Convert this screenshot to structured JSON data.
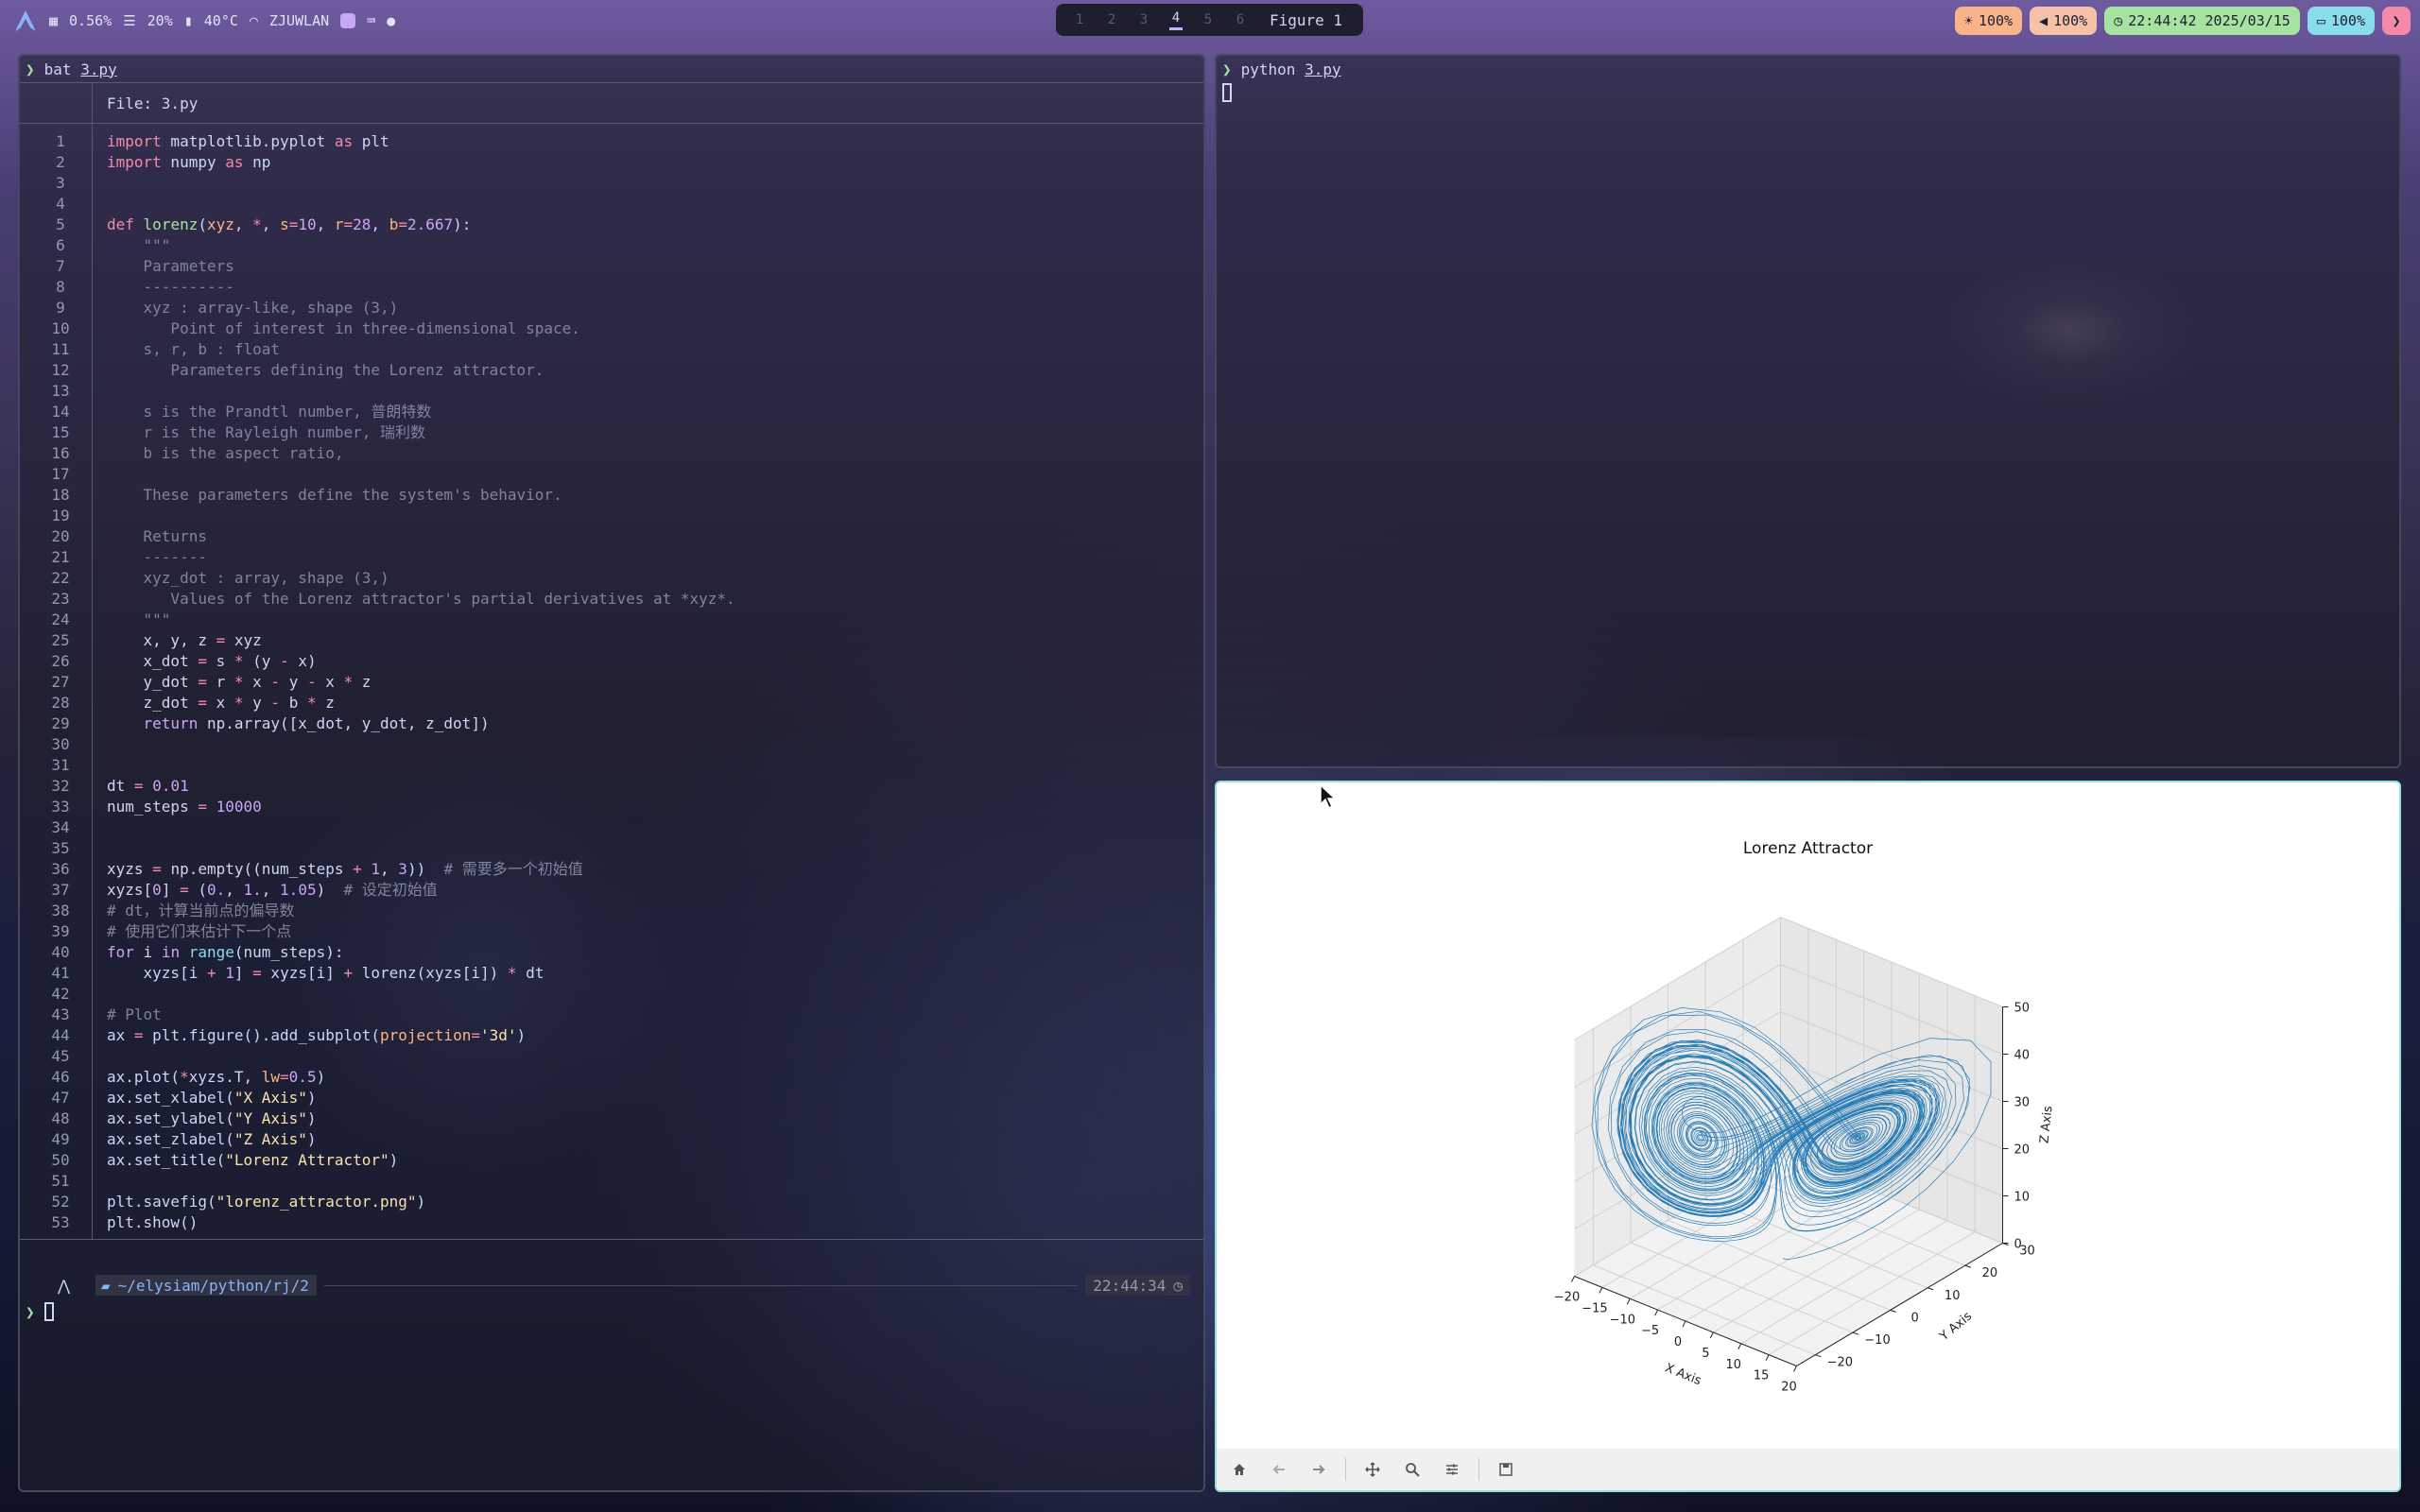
{
  "topbar": {
    "cpu": "0.56%",
    "mem": "20%",
    "temp": "40°C",
    "wifi": "ZJUWLAN",
    "workspaces": [
      "1",
      "2",
      "3",
      "4",
      "5",
      "6"
    ],
    "active_workspace": 4,
    "window_title": "Figure 1",
    "brightness": "100%",
    "volume": "100%",
    "datetime": "22:44:42 2025/03/15",
    "battery": "100%"
  },
  "left_terminal": {
    "command": "bat",
    "command_arg": "3.py",
    "file_header": "File: 3.py",
    "code_lines": [
      [
        [
          "k",
          "import"
        ],
        [
          "t",
          " matplotlib.pyplot "
        ],
        [
          "k",
          "as"
        ],
        [
          "t",
          " plt"
        ]
      ],
      [
        [
          "k",
          "import"
        ],
        [
          "t",
          " numpy "
        ],
        [
          "k",
          "as"
        ],
        [
          "t",
          " np"
        ]
      ],
      [],
      [],
      [
        [
          "k",
          "def"
        ],
        [
          "t",
          " "
        ],
        [
          "fn",
          "lorenz"
        ],
        [
          "t",
          "("
        ],
        [
          "arg",
          "xyz"
        ],
        [
          "t",
          ", "
        ],
        [
          "op",
          "*"
        ],
        [
          "t",
          ", "
        ],
        [
          "arg",
          "s"
        ],
        [
          "op",
          "="
        ],
        [
          "num",
          "10"
        ],
        [
          "t",
          ", "
        ],
        [
          "arg",
          "r"
        ],
        [
          "op",
          "="
        ],
        [
          "num",
          "28"
        ],
        [
          "t",
          ", "
        ],
        [
          "arg",
          "b"
        ],
        [
          "op",
          "="
        ],
        [
          "num",
          "2.667"
        ],
        [
          "t",
          "):"
        ]
      ],
      [
        [
          "doc",
          "    \"\"\""
        ]
      ],
      [
        [
          "doc",
          "    Parameters"
        ]
      ],
      [
        [
          "doc",
          "    ----------"
        ]
      ],
      [
        [
          "doc",
          "    xyz : array-like, shape (3,)"
        ]
      ],
      [
        [
          "doc",
          "       Point of interest in three-dimensional space."
        ]
      ],
      [
        [
          "doc",
          "    s, r, b : float"
        ]
      ],
      [
        [
          "doc",
          "       Parameters defining the Lorenz attractor."
        ]
      ],
      [],
      [
        [
          "doc",
          "    s is the Prandtl number, 普朗特数"
        ]
      ],
      [
        [
          "doc",
          "    r is the Rayleigh number, 瑞利数"
        ]
      ],
      [
        [
          "doc",
          "    b is the aspect ratio,"
        ]
      ],
      [],
      [
        [
          "doc",
          "    These parameters define the system's behavior."
        ]
      ],
      [],
      [
        [
          "doc",
          "    Returns"
        ]
      ],
      [
        [
          "doc",
          "    -------"
        ]
      ],
      [
        [
          "doc",
          "    xyz_dot : array, shape (3,)"
        ]
      ],
      [
        [
          "doc",
          "       Values of the Lorenz attractor's partial derivatives at *xyz*."
        ]
      ],
      [
        [
          "doc",
          "    \"\"\""
        ]
      ],
      [
        [
          "t",
          "    x, y, z "
        ],
        [
          "op",
          "="
        ],
        [
          "t",
          " xyz"
        ]
      ],
      [
        [
          "t",
          "    x_dot "
        ],
        [
          "op",
          "="
        ],
        [
          "t",
          " s "
        ],
        [
          "op",
          "*"
        ],
        [
          "t",
          " (y "
        ],
        [
          "op",
          "-"
        ],
        [
          "t",
          " x)"
        ]
      ],
      [
        [
          "t",
          "    y_dot "
        ],
        [
          "op",
          "="
        ],
        [
          "t",
          " r "
        ],
        [
          "op",
          "*"
        ],
        [
          "t",
          " x "
        ],
        [
          "op",
          "-"
        ],
        [
          "t",
          " y "
        ],
        [
          "op",
          "-"
        ],
        [
          "t",
          " x "
        ],
        [
          "op",
          "*"
        ],
        [
          "t",
          " z"
        ]
      ],
      [
        [
          "t",
          "    z_dot "
        ],
        [
          "op",
          "="
        ],
        [
          "t",
          " x "
        ],
        [
          "op",
          "*"
        ],
        [
          "t",
          " y "
        ],
        [
          "op",
          "-"
        ],
        [
          "t",
          " b "
        ],
        [
          "op",
          "*"
        ],
        [
          "t",
          " z"
        ]
      ],
      [
        [
          "kp",
          "    return"
        ],
        [
          "t",
          " np.array([x_dot, y_dot, z_dot])"
        ]
      ],
      [],
      [],
      [
        [
          "t",
          "dt "
        ],
        [
          "op",
          "="
        ],
        [
          "t",
          " "
        ],
        [
          "num",
          "0.01"
        ]
      ],
      [
        [
          "t",
          "num_steps "
        ],
        [
          "op",
          "="
        ],
        [
          "t",
          " "
        ],
        [
          "num",
          "10000"
        ]
      ],
      [],
      [],
      [
        [
          "t",
          "xyzs "
        ],
        [
          "op",
          "="
        ],
        [
          "t",
          " np.empty((num_steps "
        ],
        [
          "op",
          "+"
        ],
        [
          "t",
          " "
        ],
        [
          "num",
          "1"
        ],
        [
          "t",
          ", "
        ],
        [
          "num",
          "3"
        ],
        [
          "t",
          "))  "
        ],
        [
          "cm",
          "# 需要多一个初始值"
        ]
      ],
      [
        [
          "t",
          "xyzs["
        ],
        [
          "num",
          "0"
        ],
        [
          "t",
          "] "
        ],
        [
          "op",
          "="
        ],
        [
          "t",
          " ("
        ],
        [
          "num",
          "0."
        ],
        [
          "t",
          ", "
        ],
        [
          "num",
          "1."
        ],
        [
          "t",
          ", "
        ],
        [
          "num",
          "1.05"
        ],
        [
          "t",
          ")  "
        ],
        [
          "cm",
          "# 设定初始值"
        ]
      ],
      [
        [
          "cm",
          "# dt，计算当前点的偏导数"
        ]
      ],
      [
        [
          "cm",
          "# 使用它们来估计下一个点"
        ]
      ],
      [
        [
          "kp",
          "for"
        ],
        [
          "t",
          " i "
        ],
        [
          "kp",
          "in"
        ],
        [
          "t",
          " "
        ],
        [
          "bi",
          "range"
        ],
        [
          "t",
          "(num_steps):"
        ]
      ],
      [
        [
          "t",
          "    xyzs[i "
        ],
        [
          "op",
          "+"
        ],
        [
          "t",
          " "
        ],
        [
          "num",
          "1"
        ],
        [
          "t",
          "] "
        ],
        [
          "op",
          "="
        ],
        [
          "t",
          " xyzs[i] "
        ],
        [
          "op",
          "+"
        ],
        [
          "t",
          " lorenz(xyzs[i]) "
        ],
        [
          "op",
          "*"
        ],
        [
          "t",
          " dt"
        ]
      ],
      [],
      [
        [
          "cm",
          "# Plot"
        ]
      ],
      [
        [
          "t",
          "ax "
        ],
        [
          "op",
          "="
        ],
        [
          "t",
          " plt.figure().add_subplot("
        ],
        [
          "arg",
          "projection"
        ],
        [
          "op",
          "="
        ],
        [
          "str",
          "'3d'"
        ],
        [
          "t",
          ")"
        ]
      ],
      [],
      [
        [
          "t",
          "ax.plot("
        ],
        [
          "op",
          "*"
        ],
        [
          "t",
          "xyzs.T, "
        ],
        [
          "arg",
          "lw"
        ],
        [
          "op",
          "="
        ],
        [
          "num",
          "0.5"
        ],
        [
          "t",
          ")"
        ]
      ],
      [
        [
          "t",
          "ax.set_xlabel("
        ],
        [
          "str",
          "\"X Axis\""
        ],
        [
          "t",
          ")"
        ]
      ],
      [
        [
          "t",
          "ax.set_ylabel("
        ],
        [
          "str",
          "\"Y Axis\""
        ],
        [
          "t",
          ")"
        ]
      ],
      [
        [
          "t",
          "ax.set_zlabel("
        ],
        [
          "str",
          "\"Z Axis\""
        ],
        [
          "t",
          ")"
        ]
      ],
      [
        [
          "t",
          "ax.set_title("
        ],
        [
          "str",
          "\"Lorenz Attractor\""
        ],
        [
          "t",
          ")"
        ]
      ],
      [],
      [
        [
          "t",
          "plt.savefig("
        ],
        [
          "str",
          "\"lorenz_attractor.png\""
        ],
        [
          "t",
          ")"
        ]
      ],
      [
        [
          "t",
          "plt.show()"
        ]
      ]
    ],
    "status_path": "~/elysiam/python/rj/2",
    "status_time": "22:44:34"
  },
  "right_terminal": {
    "command": "python",
    "command_arg": "3.py"
  },
  "figure": {
    "title": "Lorenz Attractor",
    "toolbar": [
      "home-icon",
      "back-icon",
      "forward-icon",
      "pan-icon",
      "zoom-icon",
      "configure-icon",
      "save-icon"
    ]
  },
  "chart_data": {
    "type": "line",
    "projection": "3d",
    "title": "Lorenz Attractor",
    "xlabel": "X Axis",
    "ylabel": "Y Axis",
    "zlabel": "Z Axis",
    "xticks": [
      -20,
      -15,
      -10,
      -5,
      0,
      5,
      10,
      15,
      20
    ],
    "yticks": [
      -20,
      -10,
      0,
      10,
      20,
      30
    ],
    "zticks": [
      0,
      10,
      20,
      30,
      40,
      50
    ],
    "xlim": [
      -20,
      20
    ],
    "ylim": [
      -25,
      30
    ],
    "zlim": [
      0,
      50
    ],
    "series": [
      {
        "color": "#1f77b4",
        "lw": 0.5,
        "params": {
          "s": 10,
          "r": 28,
          "b": 2.667,
          "dt": 0.01,
          "steps": 10000,
          "x0": [
            0.0,
            1.0,
            1.05
          ]
        }
      }
    ],
    "grid": true
  }
}
